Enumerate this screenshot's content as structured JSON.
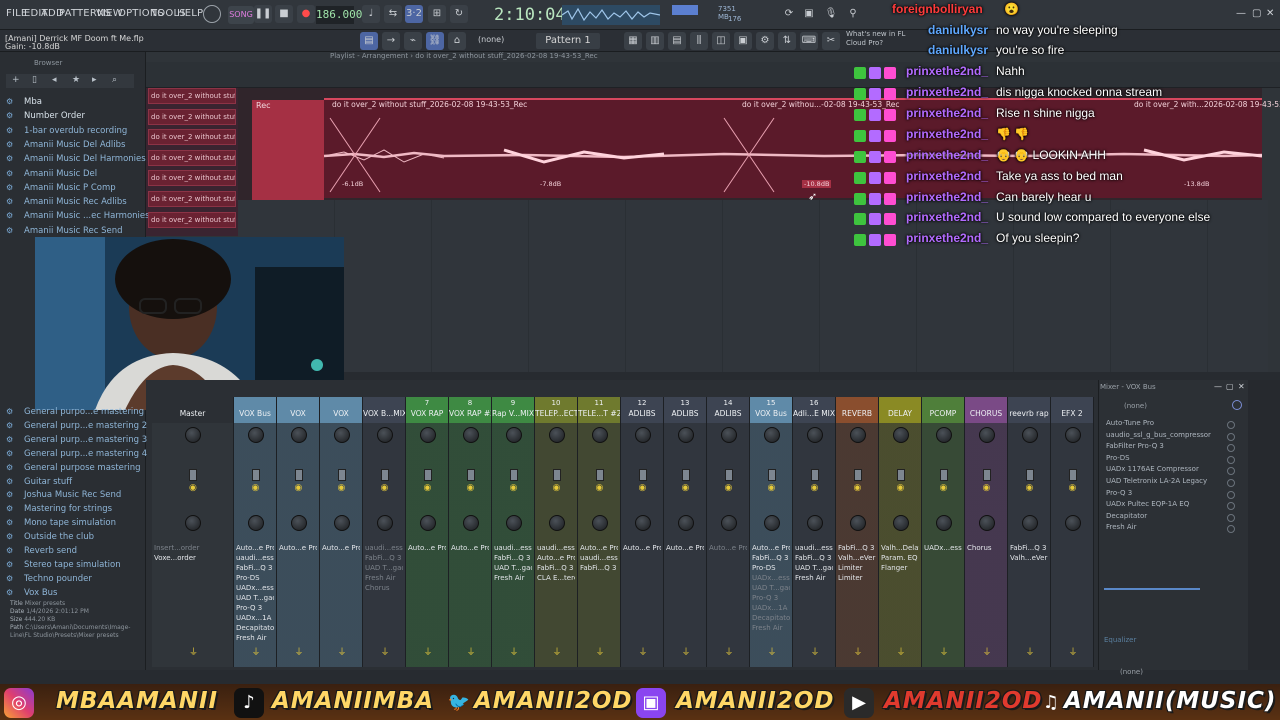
{
  "menu": [
    "FILE",
    "EDIT",
    "ADD",
    "PATTERNS",
    "VIEW",
    "OPTIONS",
    "TOOLS",
    "HELP"
  ],
  "transport": {
    "song_label": "SONG",
    "bpm": "186.000",
    "time": "2:10:04",
    "cpu": "7351 MB",
    "cpu2": "176"
  },
  "hint_bar": {
    "hint": "[Amani]   Derrick MF Doom ft Me.flp",
    "gain": "Gain: -10.8dB"
  },
  "toolbar": {
    "snap": "(none)",
    "pattern": "Pattern 1",
    "news": "What's new in FL Cloud Pro?"
  },
  "playlist": {
    "title": "Playlist - Arrangement › do it over_2 without stuff_2026-02-08 19-43-53_Rec",
    "clip_names": [
      "do it over_2 without stuff",
      "do it over_2 without stuff",
      "do it over_2 without stuff",
      "do it over_2 without stuff",
      "do it over_2 without stuff",
      "do it over_2 without stuff",
      "do it over_2 without stuff"
    ],
    "rec_label": "Rec",
    "clip_title_1": "do it over_2 without stuff_2026-02-08 19-43-53_Rec",
    "clip_title_2": "do it over_2 withou...-02-08 19-43-53_Rec",
    "clip_title_3": "do it over_2 with...2026-02-08 19-43-53_Rec",
    "db_marks": [
      "-6.1dB",
      "-7.8dB",
      "-10.8dB",
      "-13.8dB"
    ]
  },
  "browser": {
    "title": "Browser",
    "items": [
      "Mba",
      "Number Order",
      "1-bar overdub recording",
      "Amanii Music Del Adlibs",
      "Amanii Music Del Harmonies",
      "Amanii Music Del",
      "Amanii Music P Comp",
      "Amanii Music Rec Adlibs",
      "Amanii Music ...ec Harmonies",
      "Amanii Music Rec Send"
    ],
    "items_lower": [
      "General purpo...e mastering",
      "General purp...e mastering 2",
      "General purp...e mastering 3",
      "General purp...e mastering 4",
      "General purpose mastering",
      "Guitar stuff",
      "Joshua Music Rec Send",
      "Mastering for strings",
      "Mono tape simulation",
      "Outside the club",
      "Reverb send",
      "Stereo tape simulation",
      "Techno pounder",
      "Vox Bus"
    ],
    "file_meta": {
      "title": "Mixer presets",
      "date": "1/4/2026 2:01:12 PM",
      "size": "444.20 KB",
      "path": "C:\\Users\\Amani\\Documents\\Image-Line\\FL Studio\\Presets\\Mixer presets"
    }
  },
  "chat": [
    {
      "user": "foreignbolliryan",
      "msg": "😮",
      "color": "#ff3b3b"
    },
    {
      "user": "daniulkysr",
      "msg": "no way you're sleeping",
      "color": "#5fa8ff"
    },
    {
      "user": "daniulkysr",
      "msg": "you're so fire",
      "color": "#5fa8ff"
    },
    {
      "user": "prinxethe2nd_",
      "msg": "Nahh",
      "color": "#b36bff"
    },
    {
      "user": "prinxethe2nd_",
      "msg": "dis nigga knocked onna stream",
      "color": "#b36bff"
    },
    {
      "user": "prinxethe2nd_",
      "msg": "Rise n shine nigga",
      "color": "#b36bff"
    },
    {
      "user": "prinxethe2nd_",
      "msg": "👎 👎",
      "color": "#b36bff"
    },
    {
      "user": "prinxethe2nd_",
      "msg": "👴 👴 LOOKIN AHH",
      "color": "#b36bff"
    },
    {
      "user": "prinxethe2nd_",
      "msg": "Take ya ass to bed man",
      "color": "#b36bff"
    },
    {
      "user": "prinxethe2nd_",
      "msg": "Can barely hear u",
      "color": "#b36bff"
    },
    {
      "user": "prinxethe2nd_",
      "msg": "U sound low compared to everyone else",
      "color": "#b36bff"
    },
    {
      "user": "prinxethe2nd_",
      "msg": "Of you sleepin?",
      "color": "#b36bff"
    }
  ],
  "mixer": {
    "title": "Mixer - VOX Bus",
    "strips": [
      {
        "num": "",
        "name": "Master",
        "color": "#2b2f34",
        "fx": [
          "Insert...order",
          "Voxe...order"
        ],
        "dim": [
          true,
          false
        ]
      },
      {
        "num": "",
        "name": "VOX Bus",
        "color": "#5f8aa8",
        "fx": [
          "Auto...e Pro",
          "uaudi...essor",
          "FabFi...Q 3",
          "Pro-DS",
          "UADx...essor",
          "UAD T...gacy",
          "Pro-Q 3",
          "UADx...1A EQ",
          "Decapitator",
          "Fresh Air"
        ],
        "dim": [
          false,
          false,
          false,
          false,
          false,
          false,
          false,
          false,
          false,
          false
        ]
      },
      {
        "num": "",
        "name": "VOX",
        "color": "#5f8aa8",
        "fx": [
          "Auto...e Pro"
        ],
        "dim": [
          false
        ]
      },
      {
        "num": "",
        "name": "VOX",
        "color": "#5f8aa8",
        "fx": [
          "Auto...e Pro"
        ],
        "dim": [
          false
        ]
      },
      {
        "num": "",
        "name": "VOX B...MIX",
        "color": "#3d4452",
        "fx": [
          "uaudi...essor",
          "FabFi...Q 3",
          "UAD T...gacy",
          "Fresh Air",
          "Chorus"
        ],
        "dim": [
          true,
          true,
          true,
          true,
          true
        ]
      },
      {
        "num": "7",
        "name": "VOX RAP",
        "color": "#3e8a43",
        "fx": [
          "Auto...e Pro"
        ],
        "dim": [
          false
        ]
      },
      {
        "num": "8",
        "name": "VOX RAP #2",
        "color": "#3e8a43",
        "fx": [
          "Auto...e Pro"
        ],
        "dim": [
          false
        ]
      },
      {
        "num": "9",
        "name": "Rap V...MIX",
        "color": "#3e8a43",
        "fx": [
          "uaudi...essor",
          "FabFi...Q 3",
          "UAD T...gacy",
          "Fresh Air"
        ],
        "dim": [
          false,
          false,
          false,
          false
        ]
      },
      {
        "num": "10",
        "name": "TELEP...ECT",
        "color": "#6f7a2e",
        "fx": [
          "uaudi...essor",
          "Auto...e Pro",
          "FabFi...Q 3",
          "CLA E...tereo"
        ],
        "dim": [
          false,
          false,
          false,
          false
        ]
      },
      {
        "num": "11",
        "name": "TELE...T #2",
        "color": "#6f7a2e",
        "fx": [
          "Auto...e Pro",
          "uaudi...essor",
          "FabFi...Q 3"
        ],
        "dim": [
          false,
          false,
          false
        ]
      },
      {
        "num": "12",
        "name": "ADLIBS",
        "color": "#3d4452",
        "fx": [
          "Auto...e Pro"
        ],
        "dim": [
          false
        ]
      },
      {
        "num": "13",
        "name": "ADLIBS",
        "color": "#3d4452",
        "fx": [
          "Auto...e Pro"
        ],
        "dim": [
          false
        ]
      },
      {
        "num": "14",
        "name": "ADLIBS",
        "color": "#3d4452",
        "fx": [
          "Auto...e Pro"
        ],
        "dim": [
          true
        ]
      },
      {
        "num": "15",
        "name": "VOX Bus",
        "color": "#5f8aa8",
        "fx": [
          "Auto...e Pro",
          "FabFi...Q 3",
          "Pro-DS",
          "UADx...essor",
          "UAD T...gacy",
          "Pro-Q 3",
          "UADx...1A EQ",
          "Decapitator",
          "Fresh Air"
        ],
        "dim": [
          false,
          false,
          false,
          true,
          true,
          true,
          true,
          true,
          true
        ]
      },
      {
        "num": "16",
        "name": "Adli...E MIX",
        "color": "#3d4452",
        "fx": [
          "uaudi...essor",
          "FabFi...Q 3",
          "UAD T...gacy",
          "Fresh Air"
        ],
        "dim": [
          false,
          false,
          false,
          false
        ]
      },
      {
        "num": "",
        "name": "REVERB",
        "color": "#8a4e2e",
        "fx": [
          "FabFi...Q 3",
          "Valh...eVerb",
          "Limiter",
          "Limiter"
        ],
        "dim": [
          false,
          false,
          false,
          false
        ]
      },
      {
        "num": "",
        "name": "DELAY",
        "color": "#8a8a24",
        "fx": [
          "Valh...Delay",
          "Param. EQ 2",
          "Flanger"
        ],
        "dim": [
          false,
          false,
          false
        ]
      },
      {
        "num": "",
        "name": "PCOMP",
        "color": "#4f7f3a",
        "fx": [
          "UADx...essor"
        ],
        "dim": [
          false
        ]
      },
      {
        "num": "",
        "name": "CHORUS",
        "color": "#7a4a86",
        "fx": [
          "Chorus"
        ],
        "dim": [
          false
        ]
      },
      {
        "num": "",
        "name": "reevrb rap",
        "color": "#3d4452",
        "fx": [
          "FabFi...Q 3",
          "Valh...eVerb"
        ],
        "dim": [
          false,
          false
        ]
      },
      {
        "num": "",
        "name": "EFX 2",
        "color": "#3d4452",
        "fx": [],
        "dim": []
      }
    ],
    "fx_panel": {
      "input": "(none)",
      "slots": [
        "Auto-Tune Pro",
        "uaudio_ssl_g_bus_compressor",
        "FabFilter Pro-Q 3",
        "Pro-DS",
        "UADx 1176AE Compressor",
        "UAD Teletronix LA-2A Legacy",
        "Pro-Q 3",
        "UADx Pultec EQP-1A EQ",
        "Decapitator",
        "Fresh Air"
      ],
      "equalizer": "Equalizer",
      "output": "(none)"
    }
  },
  "footer": {
    "instagram": "MBAAMANII",
    "tiktok": "AMANIIMBA",
    "twitter": "AMANII2OD",
    "twitch": "AMANII2OD",
    "youtube": "AMANII2OD",
    "music": "AMANII(MUSIC)"
  },
  "colors": {
    "accent": "#d7475e",
    "chat_text": "#ffffff",
    "footer_text": "#ffd766"
  }
}
